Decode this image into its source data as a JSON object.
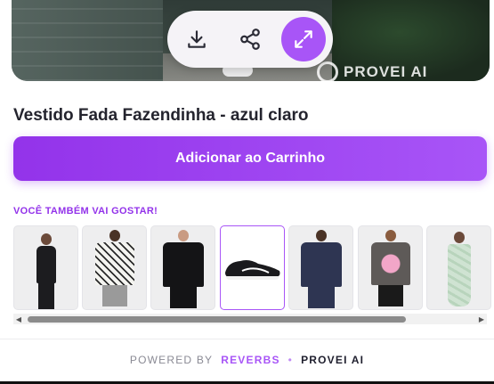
{
  "hero": {
    "watermark_text": "PROVEI AI",
    "toolbar": {
      "download_icon": "download-icon",
      "share_icon": "share-icon",
      "expand_icon": "expand-icon",
      "accent": "#a855f7"
    }
  },
  "product": {
    "title": "Vestido Fada Fazendinha - azul claro"
  },
  "cart": {
    "button_label": "Adicionar ao Carrinho",
    "color_start": "#9333ea",
    "color_end": "#a855f7"
  },
  "recommendations": {
    "label": "VOCÊ TAMBÉM VAI GOSTAR!",
    "items": [
      {
        "name": "black-jumpsuit-woman",
        "selected": false
      },
      {
        "name": "patterned-tshirt-man",
        "selected": false
      },
      {
        "name": "black-jacket-man",
        "selected": false
      },
      {
        "name": "black-sneaker",
        "selected": true
      },
      {
        "name": "navy-suit-man",
        "selected": false
      },
      {
        "name": "graphic-tshirt-man",
        "selected": false
      },
      {
        "name": "floral-dress-woman",
        "selected": false
      }
    ],
    "scroll_position": 0.0,
    "scroll_visible_fraction": 0.85
  },
  "footer": {
    "powered_by": "POWERED BY",
    "brand": "REVERBS",
    "separator": "•",
    "partner": "PROVEI AI"
  }
}
